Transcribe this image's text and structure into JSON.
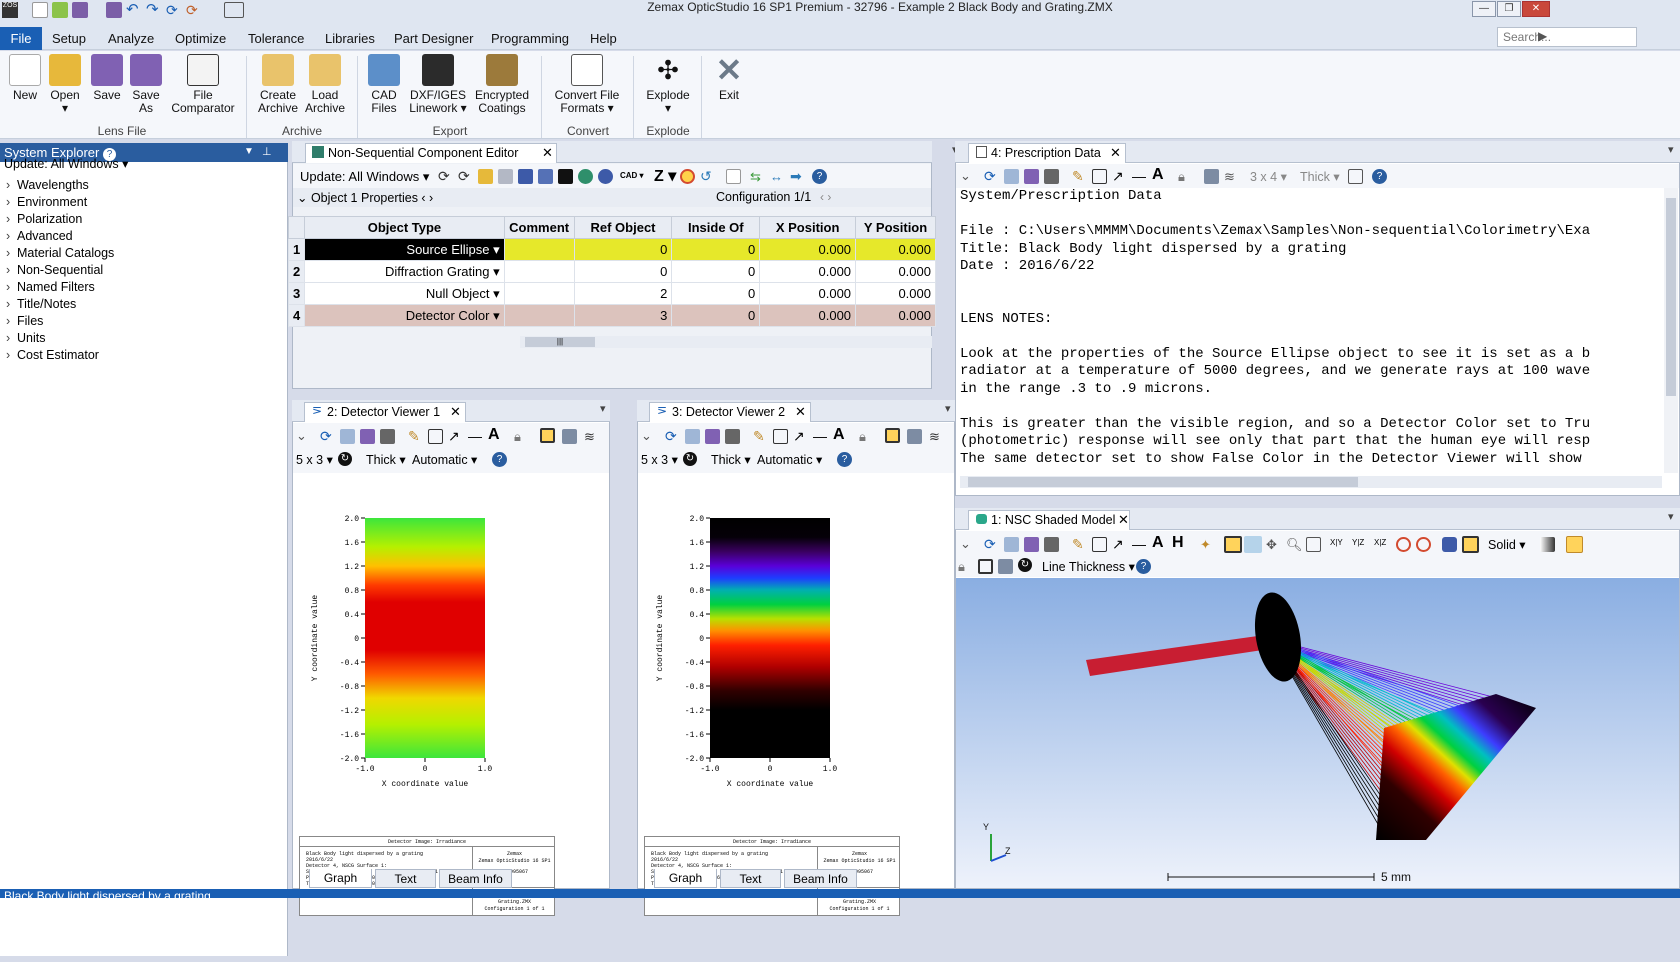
{
  "window": {
    "title": "Zemax OpticStudio 16 SP1   Premium - 32796 - Example 2 Black Body and Grating.ZMX"
  },
  "menu": {
    "file": "File",
    "items": [
      "Setup",
      "Analyze",
      "Optimize",
      "Tolerance",
      "Libraries",
      "Part Designer",
      "Programming",
      "Help"
    ]
  },
  "search": {
    "placeholder": "Search..."
  },
  "ribbon": {
    "buttons": [
      {
        "label1": "New",
        "label2": ""
      },
      {
        "label1": "Open",
        "label2": "▾"
      },
      {
        "label1": "Save",
        "label2": ""
      },
      {
        "label1": "Save",
        "label2": "As"
      },
      {
        "label1": "File",
        "label2": "Comparator"
      },
      {
        "label1": "Create",
        "label2": "Archive"
      },
      {
        "label1": "Load",
        "label2": "Archive"
      },
      {
        "label1": "CAD",
        "label2": "Files"
      },
      {
        "label1": "DXF/IGES",
        "label2": "Linework ▾"
      },
      {
        "label1": "Encrypted",
        "label2": "Coatings"
      },
      {
        "label1": "Convert File",
        "label2": "Formats ▾"
      },
      {
        "label1": "Explode",
        "label2": "▾"
      },
      {
        "label1": "Exit",
        "label2": ""
      }
    ],
    "groups": [
      "Lens File",
      "Archive",
      "Export",
      "Convert",
      "Explode"
    ]
  },
  "explorer": {
    "title": "System Explorer",
    "update": "Update: All Windows ▾",
    "items": [
      "Wavelengths",
      "Environment",
      "Polarization",
      "Advanced",
      "Material Catalogs",
      "Non-Sequential",
      "Named Filters",
      "Title/Notes",
      "Files",
      "Units",
      "Cost Estimator"
    ]
  },
  "nsc": {
    "tab": "Non-Sequential Component Editor",
    "update": "Update: All Windows ▾",
    "objprops": "Object 1 Properties",
    "config": "Configuration 1/1",
    "headers": [
      "Object Type",
      "Comment",
      "Ref Object",
      "Inside Of",
      "X Position",
      "Y Position"
    ],
    "rows": [
      {
        "num": "1",
        "type": "Source Ellipse ▾",
        "comment": "",
        "ref": "0",
        "inside": "0",
        "x": "0.000",
        "y": "0.000"
      },
      {
        "num": "2",
        "type": "Diffraction Grating ▾",
        "comment": "",
        "ref": "0",
        "inside": "0",
        "x": "0.000",
        "y": "0.000"
      },
      {
        "num": "3",
        "type": "Null Object ▾",
        "comment": "",
        "ref": "2",
        "inside": "0",
        "x": "0.000",
        "y": "0.000"
      },
      {
        "num": "4",
        "type": "Detector Color ▾",
        "comment": "",
        "ref": "3",
        "inside": "0",
        "x": "0.000",
        "y": "0.000"
      }
    ]
  },
  "prescription": {
    "tab": "4: Prescription Data",
    "grid": "3 x 4 ▾",
    "thick": "Thick ▾",
    "lines": [
      "System/Prescription Data",
      "",
      "File : C:\\Users\\MMMM\\Documents\\Zemax\\Samples\\Non-sequential\\Colorimetry\\Exa",
      "Title: Black Body light dispersed by a grating",
      "Date : 2016/6/22",
      "",
      "",
      "LENS NOTES:",
      "",
      "Look at the properties of the Source Ellipse object to see it is set as a b",
      "radiator at a temperature of 5000 degrees, and we generate rays at 100 wave",
      "in the range .3 to .9 microns.",
      "",
      "This is greater than the visible region, and so a Detector Color set to Tru",
      "(photometric) response will see only that part that the human eye will resp",
      "The same detector set to show False Color in the Detector Viewer will show "
    ]
  },
  "detector1": {
    "tab": "2: Detector Viewer 1",
    "grid": "5 x 3 ▾",
    "thick": "Thick ▾",
    "auto": "Automatic ▾",
    "ylabel": "Y coordinate value",
    "xlabel": "X coordinate value",
    "yticks": [
      "2.0",
      "1.6",
      "1.2",
      "0.8",
      "0.4",
      "0",
      "-0.4",
      "-0.8",
      "-1.2",
      "-1.6",
      "-2.0"
    ],
    "xticks": [
      "-1.0",
      "0",
      "1.0"
    ],
    "caption_title": "Detector Image: Irradiance",
    "caption_left": [
      "Black Body light dispersed by a grating",
      "2016/6/22",
      "Detector 4, NSCG Surface 1:",
      "Size 2.000 W X 4.000 H Millimeters, Pixels 1 W X 50 H, Total Hits = 995067",
      "Peak Irradiance : 1.4900E+06 Watts/cm^2",
      "Total Power     : 4.7334E+01 Watts"
    ],
    "caption_right1": "Zemax\nZemax OpticStudio 16 SP1",
    "caption_right2": "Example 2 Black Body and Grating.ZMX\nConfiguration 1 of 1",
    "bottom_tabs": [
      "Graph",
      "Text",
      "Beam Info"
    ]
  },
  "detector2": {
    "tab": "3: Detector Viewer 2",
    "grid": "5 x 3 ▾",
    "thick": "Thick ▾",
    "auto": "Automatic ▾",
    "ylabel": "Y coordinate value",
    "xlabel": "X coordinate value",
    "yticks": [
      "2.0",
      "1.6",
      "1.2",
      "0.8",
      "0.4",
      "0",
      "-0.4",
      "-0.8",
      "-1.2",
      "-1.6",
      "-2.0"
    ],
    "xticks": [
      "-1.0",
      "0",
      "1.0"
    ],
    "caption_title": "Detector Image: Irradiance",
    "caption_left": [
      "Black Body light dispersed by a grating",
      "2016/6/22",
      "Detector 4, NSCG Surface 1:",
      "Size 2.000 W X 4.000 H Millimeters, Pixels 1 W X 50 H, Total Hits = 995067",
      "Peak Illuminance : 1.160E+06 Lumens/cm^2",
      "Total Flux       : 1.489E+06 Lumens"
    ],
    "caption_right1": "Zemax\nZemax OpticStudio 16 SP1",
    "caption_right2": "Example 2 Black Body and Grating.ZMX\nConfiguration 1 of 1",
    "bottom_tabs": [
      "Graph",
      "Text",
      "Beam Info"
    ]
  },
  "shaded": {
    "tab": "1: NSC Shaded Model",
    "solid": "Solid ▾",
    "linethick": "Line Thickness ▾",
    "xyz": [
      "X|Y",
      "Y|Z",
      "X|Z"
    ],
    "scale": "5 mm",
    "axis_z": "Z",
    "axis_y": "Y"
  },
  "status": {
    "text": "Black Body light dispersed by a grating"
  },
  "colors": {
    "accent": "#1a5fb4",
    "selected_row": "#e6e82a",
    "detector_row": "#dcc3bd"
  }
}
